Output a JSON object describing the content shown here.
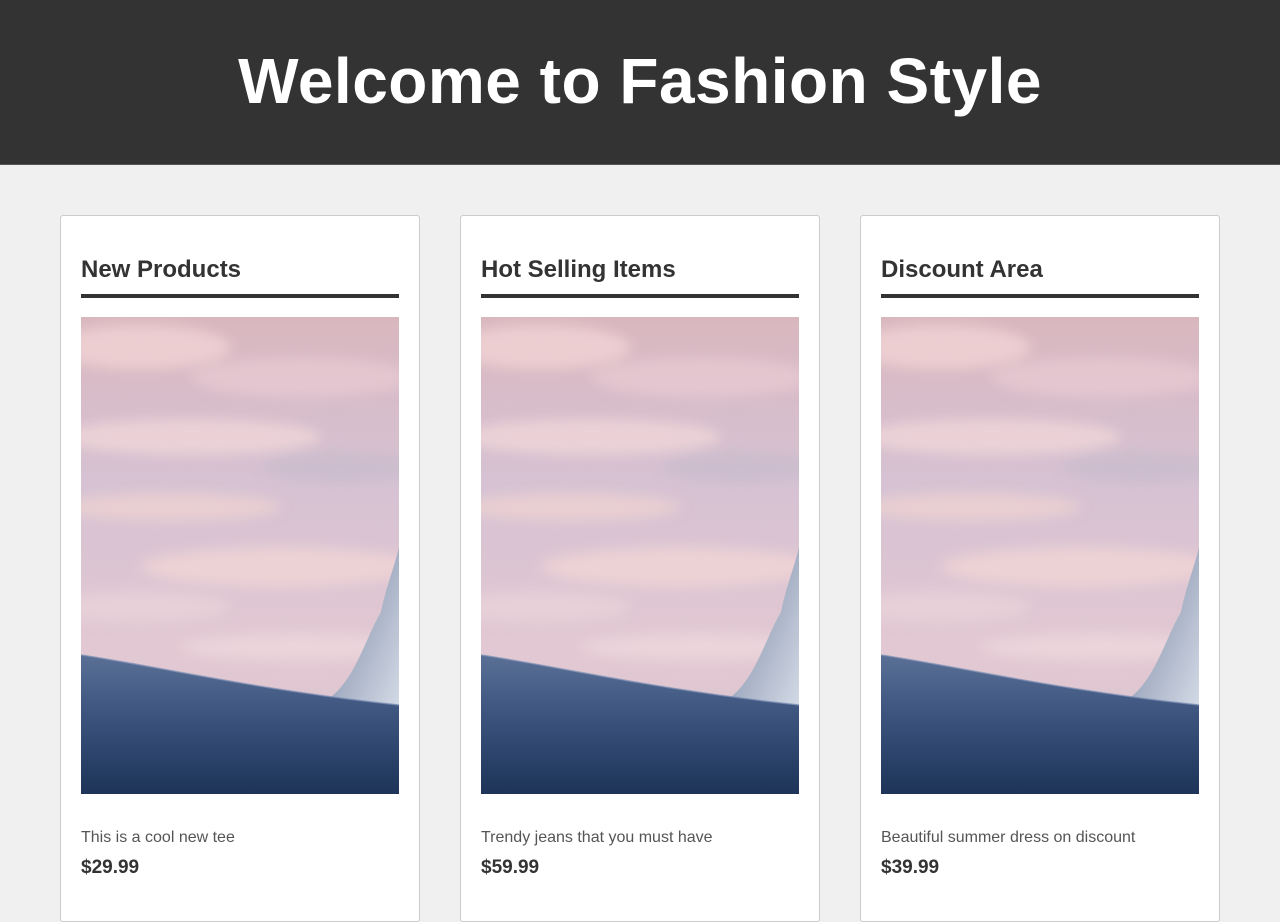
{
  "header": {
    "title": "Welcome to Fashion Style",
    "background": "#333333"
  },
  "cards": [
    {
      "heading": "New Products",
      "description": "This is a cool new tee",
      "price": "$29.99",
      "image": "mountain-sunset-photo"
    },
    {
      "heading": "Hot Selling Items",
      "description": "Trendy jeans that you must have",
      "price": "$59.99",
      "image": "mountain-sunset-photo"
    },
    {
      "heading": "Discount Area",
      "description": "Beautiful summer dress on discount",
      "price": "$39.99",
      "image": "mountain-sunset-photo"
    }
  ]
}
